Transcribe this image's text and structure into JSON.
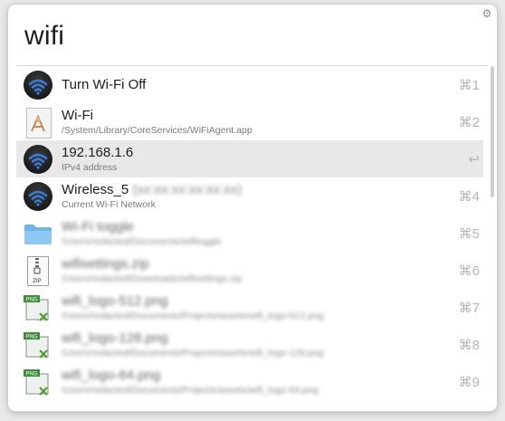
{
  "query": "wifi",
  "results": [
    {
      "title": "Turn Wi-Fi Off",
      "subtitle": "",
      "shortcut": "⌘1",
      "icon": "wifi-icon",
      "selected": false
    },
    {
      "title": "Wi-Fi",
      "subtitle": "/System/Library/CoreServices/WiFiAgent.app",
      "shortcut": "⌘2",
      "icon": "app-document-icon",
      "selected": false
    },
    {
      "title": "192.168.1.6",
      "subtitle": "IPv4 address",
      "shortcut": "↩",
      "icon": "wifi-icon",
      "selected": true
    },
    {
      "title": "Wireless_5",
      "title_hidden": "(xx:xx:xx:xx:xx:xx)",
      "subtitle": "Current Wi-Fi Network",
      "shortcut": "⌘4",
      "icon": "wifi-icon",
      "selected": false
    },
    {
      "title": "Wi-Fi toggle",
      "subtitle": "/Users/redacted/Documents/wifitoggle",
      "shortcut": "⌘5",
      "icon": "folder-icon",
      "selected": false,
      "redacted": true
    },
    {
      "title": "wifisettings.zip",
      "subtitle": "/Users/redacted/Downloads/wifisettings.zip",
      "shortcut": "⌘6",
      "icon": "zip-icon",
      "selected": false,
      "redacted": true
    },
    {
      "title": "wifi_logo-512.png",
      "subtitle": "/Users/redacted/Documents/Projects/assets/wifi_logo-512.png",
      "shortcut": "⌘7",
      "icon": "png-icon",
      "selected": false,
      "redacted": true
    },
    {
      "title": "wifi_logo-128.png",
      "subtitle": "/Users/redacted/Documents/Projects/assets/wifi_logo-128.png",
      "shortcut": "⌘8",
      "icon": "png-icon",
      "selected": false,
      "redacted": true
    },
    {
      "title": "wifi_logo-64.png",
      "subtitle": "/Users/redacted/Documents/Projects/assets/wifi_logo-64.png",
      "shortcut": "⌘9",
      "icon": "png-icon",
      "selected": false,
      "redacted": true
    }
  ],
  "colors": {
    "selected_row": "#e8e8e8",
    "shortcut": "#b4b4b4",
    "wifi_blue": "#3a7bd5"
  }
}
